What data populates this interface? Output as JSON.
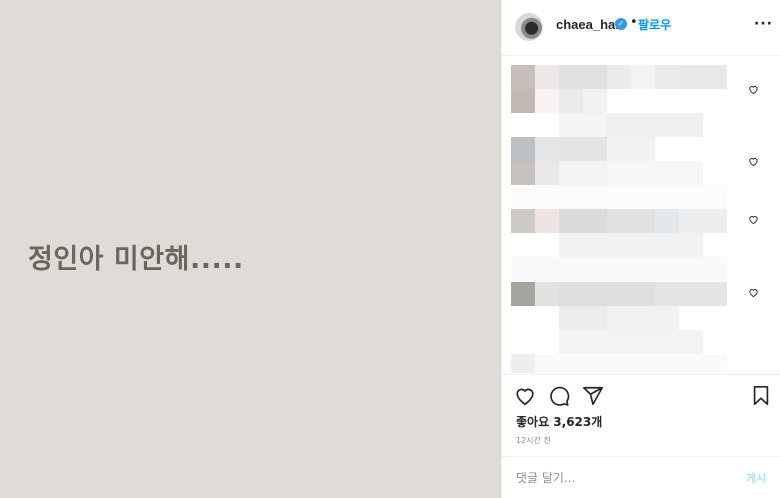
{
  "post": {
    "image_text": "정인아 미안해.....",
    "image_bg_color": "#dfdcd7",
    "image_text_color": "#6e655c"
  },
  "header": {
    "username": "chaea_han",
    "verified": true,
    "verified_icon": "verified-badge-icon",
    "separator": "•",
    "follow_label": "팔로우",
    "more_label": "···",
    "more_icon": "more-options-icon"
  },
  "comments": {
    "note": "",
    "count_visible": 5
  },
  "actions": {
    "icons": [
      "heart-icon",
      "comment-icon",
      "share-icon",
      "bookmark-icon"
    ],
    "likes_text": "좋아요 3,623개",
    "time_text": "12시간 전"
  },
  "comment_box": {
    "placeholder": "댓글 달기...",
    "post_label": "게시"
  },
  "colors": {
    "accent": "#0095f6",
    "verified": "#3897f0",
    "post_disabled": "#b2dffc"
  }
}
